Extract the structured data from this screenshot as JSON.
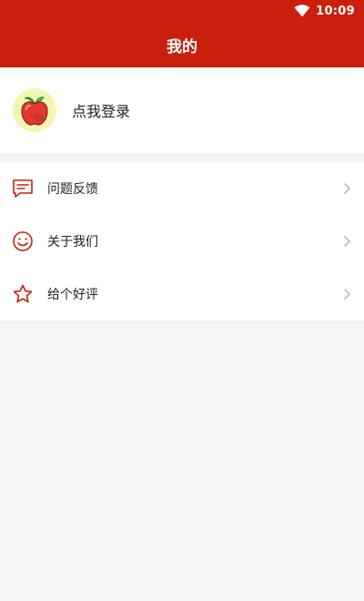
{
  "status_bar": {
    "time": "10:09",
    "wifi_icon": "wifi-icon"
  },
  "app_bar": {
    "title": "我的"
  },
  "profile": {
    "avatar_icon": "apple-avatar-icon",
    "login_text": "点我登录"
  },
  "menu": {
    "items": [
      {
        "label": "问题反馈",
        "icon": "message-icon"
      },
      {
        "label": "关于我们",
        "icon": "smile-icon"
      },
      {
        "label": "给个好评",
        "icon": "star-icon"
      }
    ]
  },
  "colors": {
    "primary": "#c8200c",
    "background": "#f4f5f7",
    "chevron": "#b0b0b0"
  }
}
